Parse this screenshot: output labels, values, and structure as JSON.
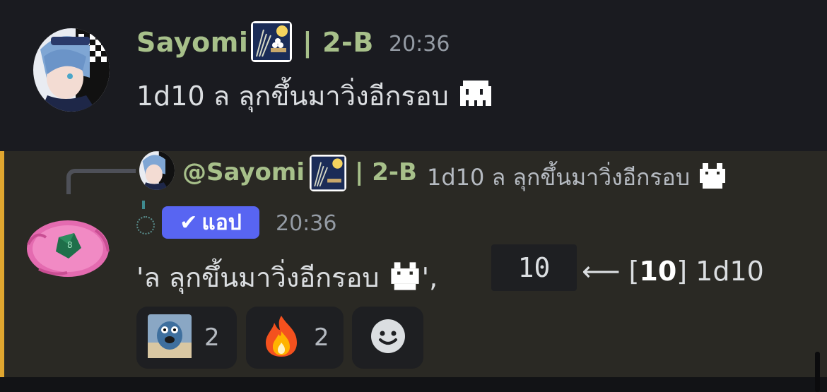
{
  "message1": {
    "username": "Sayomi",
    "role_tag": "| 2-B",
    "timestamp": "20:36",
    "text": "1d10 ล ลุกขึ้นมาวิ่งอีกรอบ"
  },
  "message2": {
    "reply": {
      "mention": "@Sayomi",
      "role_tag": "| 2-B",
      "text": "1d10 ล ลุกขึ้นมาวิ่งอีกรอบ"
    },
    "app_badge_label": "แอป",
    "timestamp": "20:36",
    "text_prefix": "'ล ลุกขึ้นมาวิ่งอีกรอบ",
    "text_suffix": "',",
    "code_value": "10",
    "result_arrow": "⟵ [",
    "result_value": "10",
    "result_tail": "] 1d10",
    "reactions": [
      {
        "emoji": "fish-meme",
        "count": "2"
      },
      {
        "emoji": "fire",
        "count": "2"
      }
    ]
  },
  "colors": {
    "username": "#a7c08a",
    "app_badge": "#5865f2",
    "accent_bar": "#e0a62f"
  }
}
